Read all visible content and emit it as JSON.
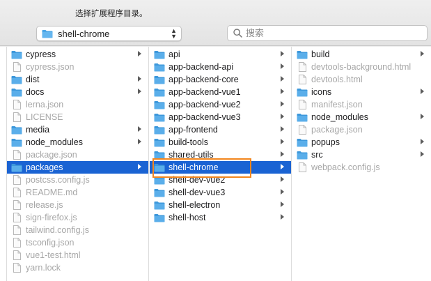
{
  "header": {
    "prompt": "选择扩展程序目录。",
    "location_popup": {
      "selected": "shell-chrome"
    },
    "search": {
      "placeholder": "搜索",
      "value": ""
    }
  },
  "icons": {
    "folder": "folder-icon",
    "file": "document-icon",
    "search": "search-icon",
    "chevron": "chevron-updown-icon",
    "disclosure": "chevron-right-icon"
  },
  "colors": {
    "folder_blue": "#4aa5e6",
    "selection": "#1a63d3",
    "highlight_outline": "#f2861e"
  },
  "columns": [
    {
      "items": [
        {
          "label": "cypress",
          "type": "folder",
          "selected": false
        },
        {
          "label": "cypress.json",
          "type": "file",
          "selected": false
        },
        {
          "label": "dist",
          "type": "folder",
          "selected": false
        },
        {
          "label": "docs",
          "type": "folder",
          "selected": false
        },
        {
          "label": "lerna.json",
          "type": "file",
          "selected": false
        },
        {
          "label": "LICENSE",
          "type": "file",
          "selected": false
        },
        {
          "label": "media",
          "type": "folder",
          "selected": false
        },
        {
          "label": "node_modules",
          "type": "folder",
          "selected": false
        },
        {
          "label": "package.json",
          "type": "file",
          "selected": false
        },
        {
          "label": "packages",
          "type": "folder",
          "selected": true
        },
        {
          "label": "postcss.config.js",
          "type": "file",
          "selected": false
        },
        {
          "label": "README.md",
          "type": "file",
          "selected": false
        },
        {
          "label": "release.js",
          "type": "file",
          "selected": false
        },
        {
          "label": "sign-firefox.js",
          "type": "file",
          "selected": false
        },
        {
          "label": "tailwind.config.js",
          "type": "file",
          "selected": false
        },
        {
          "label": "tsconfig.json",
          "type": "file",
          "selected": false
        },
        {
          "label": "vue1-test.html",
          "type": "file",
          "selected": false
        },
        {
          "label": "yarn.lock",
          "type": "file",
          "selected": false
        }
      ]
    },
    {
      "items": [
        {
          "label": "api",
          "type": "folder",
          "selected": false
        },
        {
          "label": "app-backend-api",
          "type": "folder",
          "selected": false
        },
        {
          "label": "app-backend-core",
          "type": "folder",
          "selected": false
        },
        {
          "label": "app-backend-vue1",
          "type": "folder",
          "selected": false
        },
        {
          "label": "app-backend-vue2",
          "type": "folder",
          "selected": false
        },
        {
          "label": "app-backend-vue3",
          "type": "folder",
          "selected": false
        },
        {
          "label": "app-frontend",
          "type": "folder",
          "selected": false
        },
        {
          "label": "build-tools",
          "type": "folder",
          "selected": false
        },
        {
          "label": "shared-utils",
          "type": "folder",
          "selected": false
        },
        {
          "label": "shell-chrome",
          "type": "folder",
          "selected": true
        },
        {
          "label": "shell-dev-vue2",
          "type": "folder",
          "selected": false
        },
        {
          "label": "shell-dev-vue3",
          "type": "folder",
          "selected": false
        },
        {
          "label": "shell-electron",
          "type": "folder",
          "selected": false
        },
        {
          "label": "shell-host",
          "type": "folder",
          "selected": false
        }
      ]
    },
    {
      "items": [
        {
          "label": "build",
          "type": "folder",
          "selected": false
        },
        {
          "label": "devtools-background.html",
          "type": "file",
          "selected": false
        },
        {
          "label": "devtools.html",
          "type": "file",
          "selected": false
        },
        {
          "label": "icons",
          "type": "folder",
          "selected": false
        },
        {
          "label": "manifest.json",
          "type": "file",
          "selected": false
        },
        {
          "label": "node_modules",
          "type": "folder",
          "selected": false
        },
        {
          "label": "package.json",
          "type": "file",
          "selected": false
        },
        {
          "label": "popups",
          "type": "folder",
          "selected": false
        },
        {
          "label": "src",
          "type": "folder",
          "selected": false
        },
        {
          "label": "webpack.config.js",
          "type": "file",
          "selected": false
        }
      ]
    }
  ]
}
